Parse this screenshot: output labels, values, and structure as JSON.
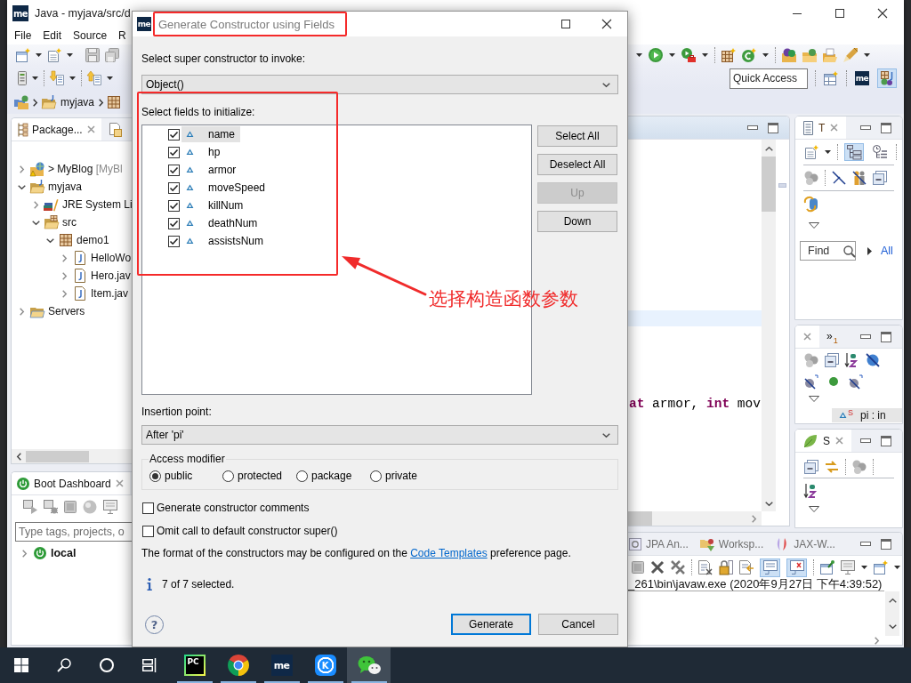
{
  "ide_window": {
    "logo_text": "me",
    "title": "Java - myjava/src/d",
    "menu": [
      "File",
      "Edit",
      "Source",
      "R"
    ],
    "quick_access": {
      "placeholder": "Quick Access"
    },
    "perspectives": [
      {
        "kind": "open",
        "selected": false
      },
      {
        "kind": "myeclipse",
        "label": "me",
        "selected": false
      },
      {
        "kind": "java",
        "selected": true
      }
    ],
    "breadcrumb": [
      "myjava"
    ],
    "package_explorer": {
      "tab": "Package...",
      "tree": [
        {
          "kind": "web-project",
          "label": "> MyBlog",
          "decoration": "[MyBl",
          "expanded": false
        },
        {
          "kind": "project",
          "label": "myjava",
          "expanded": true,
          "children": [
            {
              "kind": "library",
              "label": "JRE System Li",
              "expanded": false
            },
            {
              "kind": "source-folder",
              "label": "src",
              "expanded": true,
              "children": [
                {
                  "kind": "package",
                  "label": "demo1",
                  "expanded": true,
                  "children": [
                    {
                      "kind": "java-file",
                      "label": "HelloWo",
                      "expanded": false
                    },
                    {
                      "kind": "java-file",
                      "label": "Hero.jav",
                      "expanded": false
                    },
                    {
                      "kind": "java-file",
                      "label": "Item.jav",
                      "expanded": false
                    }
                  ]
                }
              ]
            }
          ]
        },
        {
          "kind": "folder",
          "label": "Servers",
          "expanded": false
        }
      ]
    },
    "boot_dashboard": {
      "tab": "Boot Dashboard",
      "search": {
        "placeholder": "Type tags, projects, o"
      },
      "tree": [
        {
          "kind": "target",
          "label": "local",
          "expanded": false
        }
      ]
    },
    "editor": {
      "code_line": "**at** armor, **int** mov"
    },
    "type_panel": {
      "tab": "T",
      "view_toggles": [
        {
          "kind": "hierarchy",
          "selected": true
        },
        {
          "kind": "history",
          "selected": false
        }
      ],
      "find": {
        "placeholder": "Find"
      },
      "filter_link": "All"
    },
    "outline_panel": {
      "overflow": "»",
      "overflow_count": "1",
      "items": [
        {
          "label": "pi : in",
          "marker": "S",
          "selected": true
        }
      ]
    },
    "spring_panel": {
      "tab": "S"
    },
    "console_panel": {
      "tabs": [
        {
          "kind": "jpa",
          "label": "JPA An..."
        },
        {
          "kind": "workspace",
          "label": "Worksp..."
        },
        {
          "kind": "jaxws",
          "label": "JAX-W..."
        }
      ],
      "toggles": [
        {
          "kind": "stdout",
          "on": true
        },
        {
          "kind": "stderr",
          "on": true
        }
      ],
      "header": "_261\\bin\\javaw.exe (2020年9月27日 下午4:39:52)"
    }
  },
  "dialog": {
    "logo_text": "me",
    "title": "Generate Constructor using Fields",
    "super_label": "Select super constructor to invoke:",
    "super_constructor": "Object()",
    "fields_label": "Select fields to initialize:",
    "fields": [
      {
        "name": "name",
        "checked": true,
        "selected": true
      },
      {
        "name": "hp",
        "checked": true,
        "selected": false
      },
      {
        "name": "armor",
        "checked": true,
        "selected": false
      },
      {
        "name": "moveSpeed",
        "checked": true,
        "selected": false
      },
      {
        "name": "killNum",
        "checked": true,
        "selected": false
      },
      {
        "name": "deathNum",
        "checked": true,
        "selected": false
      },
      {
        "name": "assistsNum",
        "checked": true,
        "selected": false
      }
    ],
    "side_buttons": [
      {
        "label": "Select All",
        "disabled": false
      },
      {
        "label": "Deselect All",
        "disabled": false
      },
      {
        "label": "Up",
        "disabled": true
      },
      {
        "label": "Down",
        "disabled": false
      }
    ],
    "insertion_label": "Insertion point:",
    "insertion_point": "After 'pi'",
    "access_label": "Access modifier",
    "access_modifiers": [
      {
        "label": "public",
        "selected": true
      },
      {
        "label": "protected",
        "selected": false
      },
      {
        "label": "package",
        "selected": false
      },
      {
        "label": "private",
        "selected": false
      }
    ],
    "options": [
      {
        "label": "Generate constructor comments",
        "checked": false
      },
      {
        "label": "Omit call to default constructor super()",
        "checked": false
      }
    ],
    "note": {
      "before": "The format of the constructors may be configured on the ",
      "link": "Code Templates",
      "after": " preference page."
    },
    "status": "7 of 7 selected.",
    "help_glyph": "?",
    "buttons": [
      {
        "label": "Generate",
        "default": true
      },
      {
        "label": "Cancel",
        "default": false
      }
    ]
  },
  "annotation": {
    "text": "选择构造函数参数"
  },
  "taskbar": {
    "apps": [
      {
        "kind": "pycharm",
        "label": "PC",
        "running": true,
        "selected": false
      },
      {
        "kind": "chrome",
        "running": true,
        "selected": false
      },
      {
        "kind": "myeclipse",
        "label": "me",
        "running": true,
        "selected": false
      },
      {
        "kind": "kugou",
        "label": "K",
        "running": true,
        "selected": false
      },
      {
        "kind": "wechat",
        "running": true,
        "selected": true
      }
    ]
  }
}
